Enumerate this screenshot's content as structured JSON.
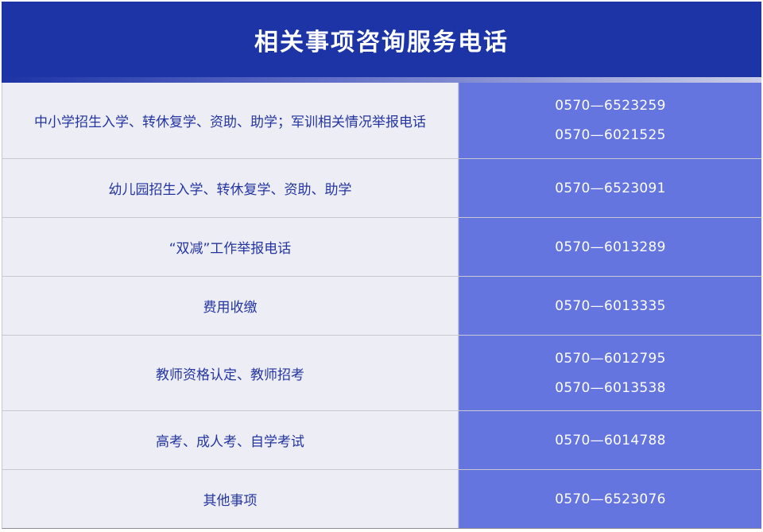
{
  "header": {
    "title": "相关事项咨询服务电话"
  },
  "rows": [
    {
      "item": "中小学招生入学、转休复学、资助、助学；军训相关情况举报电话",
      "phones": [
        "0570—6523259",
        "0570—6021525"
      ]
    },
    {
      "item": "幼儿园招生入学、转休复学、资助、助学",
      "phones": [
        "0570—6523091"
      ]
    },
    {
      "item": "“双减”工作举报电话",
      "phones": [
        "0570—6013289"
      ]
    },
    {
      "item": "费用收缴",
      "phones": [
        "0570—6013335"
      ]
    },
    {
      "item": "教师资格认定、教师招考",
      "phones": [
        "0570—6012795",
        "0570—6013538"
      ]
    },
    {
      "item": "高考、成人考、自学考试",
      "phones": [
        "0570—6014788"
      ]
    },
    {
      "item": "其他事项",
      "phones": [
        "0570—6523076"
      ]
    }
  ],
  "colors": {
    "header_bg": "#1d34a6",
    "item_bg": "#ededf5",
    "item_text": "#2535a0",
    "phone_bg": "#6575e0",
    "phone_text": "#ffffff"
  }
}
